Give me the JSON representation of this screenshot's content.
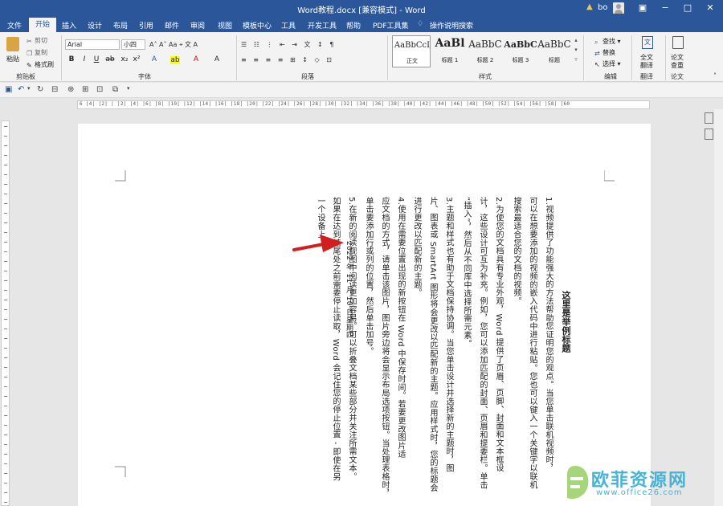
{
  "window": {
    "title": "Word教程.docx [兼容模式] - Word",
    "user": "bo"
  },
  "tabs": [
    "文件",
    "开始",
    "插入",
    "设计",
    "布局",
    "引用",
    "邮件",
    "审阅",
    "视图",
    "模板中心",
    "工具",
    "开发工具",
    "帮助",
    "PDF工具集",
    "操作说明搜索"
  ],
  "ribbon": {
    "clipboard": {
      "paste": "粘贴",
      "cut": "剪切",
      "copy": "复制",
      "painter": "格式刷",
      "label": "剪贴板"
    },
    "font": {
      "name": "Arial",
      "size": "小四",
      "label": "字体"
    },
    "paragraph": {
      "label": "段落"
    },
    "styles": {
      "label": "样式",
      "items": [
        {
          "sample": "AaBbCcI",
          "name": "正文"
        },
        {
          "sample": "AaBl",
          "name": "标题 1"
        },
        {
          "sample": "AaBbC",
          "name": "标题 2"
        },
        {
          "sample": "AaBbC",
          "name": "标题 3"
        },
        {
          "sample": "AaBbC",
          "name": "标题"
        }
      ]
    },
    "editing": {
      "find": "查找",
      "replace": "替换",
      "select": "选择",
      "label": "编辑"
    },
    "translate": {
      "btn1": "全文",
      "btn2": "翻译",
      "label": "翻译"
    },
    "paper": {
      "btn1": "论文",
      "btn2": "查重",
      "label": "论文"
    }
  },
  "ruler": "6 |4| |2| | |2| |4| |6| |8| |10| |12| |14| |16| |18| |20| |22| |24| |26| |28| |30| |32| |34| |36| |38| |40| |42| |44| |46| |48| |50| |52| |54| |56| |58| |60",
  "document": {
    "title": "这里是举例标题",
    "lines": [
      "1.视频提供了功能强大的方法帮助您证明您的观点。当您单击联机视频时，",
      "可以在想要添加的视频的嵌入代码中进行粘贴。您也可以键入一个关键字以联机",
      "搜索最适合您的文档的视频。",
      "2.为使您的文档具有专业外观，Word 提供了页眉、页脚、封面和文本框设",
      "计，这些设计可互为补充。例如，您可以添加匹配的封面、页眉和提要栏。单击",
      "“插入”，然后从不同库中选择所需元素。",
      "3.主题和样式也有助于文档保持协调。当您单击设计并选择新的主题时，图",
      "片、图表或 SmartArt 图形将会更改以匹配新的主题。应用样式时，您的标题会",
      "进行更改以匹配新的主题。",
      "4.使用在需要位置出现的新按钮在 Word 中保存时间。若要更改图片适",
      "应文档的方式，请单击该图片，图片旁边将会显示布局选项按钮。当处理表格时，",
      "单击要添加行或列的位置，然后单击加号。",
      "5.在新的阅读视图中阅读更加容易。可以折叠文档某些部分并关注所需文本。",
      "如果在达到结尾处之前需要停止读取，Word 会记住您的停止位置 - 即使在另",
      "一个设备上。",
      "2022 年 11 月 10 日星期四"
    ]
  },
  "watermark": {
    "text": "欧菲资源网",
    "url": "www.office26.com"
  },
  "colors": {
    "accent": "#2b579a",
    "arrow": "#d21e1e",
    "watermark": "#49b3d6"
  }
}
